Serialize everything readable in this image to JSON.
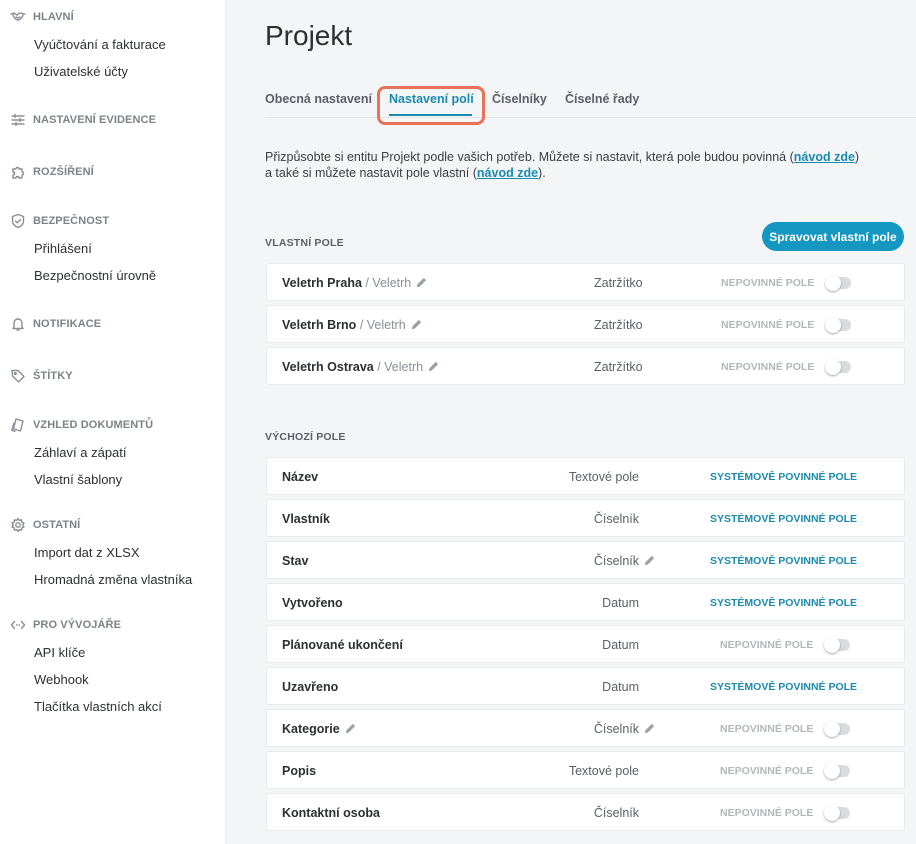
{
  "sidebar": {
    "sections": [
      {
        "label": "HLAVNÍ",
        "icon": "handshake-icon",
        "items": [
          "Vyúčtování a fakturace",
          "Uživatelské účty"
        ]
      },
      {
        "label": "NASTAVENÍ EVIDENCE",
        "icon": "sliders-icon",
        "items": []
      },
      {
        "label": "ROZŠÍŘENÍ",
        "icon": "puzzle-icon",
        "items": []
      },
      {
        "label": "BEZPEČNOST",
        "icon": "shield-check-icon",
        "items": [
          "Přihlášení",
          "Bezpečnostní úrovně"
        ]
      },
      {
        "label": "NOTIFIKACE",
        "icon": "bell-icon",
        "items": []
      },
      {
        "label": "ŠTÍTKY",
        "icon": "tag-icon",
        "items": []
      },
      {
        "label": "VZHLED DOKUMENTŮ",
        "icon": "documents-icon",
        "items": [
          "Záhlaví a zápatí",
          "Vlastní šablony"
        ]
      },
      {
        "label": "OSTATNÍ",
        "icon": "gear-icon",
        "items": [
          "Import dat z XLSX",
          "Hromadná změna vlastníka"
        ]
      },
      {
        "label": "PRO VÝVOJÁŘE",
        "icon": "code-icon",
        "items": [
          "API klíče",
          "Webhook",
          "Tlačítka vlastních akcí"
        ]
      }
    ]
  },
  "page": {
    "title": "Projekt",
    "tabs": [
      "Obecná nastavení",
      "Nastavení polí",
      "Číselníky",
      "Číselné řady"
    ],
    "active_tab": "Nastavení polí",
    "intro": {
      "text1": "Přizpůsobte si entitu Projekt podle vašich potřeb. Můžete si nastavit, která pole budou povinná (",
      "link1": "návod zde",
      "text2": ") a také si můžete nastavit pole vlastní (",
      "link2": "návod zde",
      "text3": ")."
    },
    "custom_section_title": "VLASTNÍ POLE",
    "manage_button": "Spravovat vlastní pole",
    "default_section_title": "VÝCHOZÍ POLE",
    "custom_fields": [
      {
        "name": "Veletrh Praha",
        "group": "/ Veletrh",
        "type": "Zatržítko",
        "requirement": "NEPOVINNÉ POLE",
        "enabled": false
      },
      {
        "name": "Veletrh Brno",
        "group": "/ Veletrh",
        "type": "Zatržítko",
        "requirement": "NEPOVINNÉ POLE",
        "enabled": false
      },
      {
        "name": "Veletrh Ostrava",
        "group": "/ Veletrh",
        "type": "Zatržítko",
        "requirement": "NEPOVINNÉ POLE",
        "enabled": false
      }
    ],
    "default_fields": [
      {
        "name": "Název",
        "type": "Textové pole",
        "requirement": "SYSTÉMOVĚ POVINNÉ POLE"
      },
      {
        "name": "Vlastník",
        "type": "Číselník",
        "requirement": "SYSTÉMOVĚ POVINNÉ POLE"
      },
      {
        "name": "Stav",
        "type": "Číselník",
        "requirement": "SYSTÉMOVĚ POVINNÉ POLE"
      },
      {
        "name": "Vytvořeno",
        "type": "Datum",
        "requirement": "SYSTÉMOVĚ POVINNÉ POLE"
      },
      {
        "name": "Plánované ukončení",
        "type": "Datum",
        "requirement": "NEPOVINNÉ POLE",
        "enabled": false
      },
      {
        "name": "Uzavřeno",
        "type": "Datum",
        "requirement": "SYSTÉMOVĚ POVINNÉ POLE"
      },
      {
        "name": "Kategorie",
        "type": "Číselník",
        "requirement": "NEPOVINNÉ POLE",
        "enabled": false
      },
      {
        "name": "Popis",
        "type": "Textové pole",
        "requirement": "NEPOVINNÉ POLE",
        "enabled": false
      },
      {
        "name": "Kontaktní osoba",
        "type": "Číselník",
        "requirement": "NEPOVINNÉ POLE",
        "enabled": false
      }
    ]
  },
  "colors": {
    "accent": "#1a8ab0",
    "button": "#1497c1",
    "highlight": "#e8725a",
    "optional_text": "#b3b7bc"
  }
}
